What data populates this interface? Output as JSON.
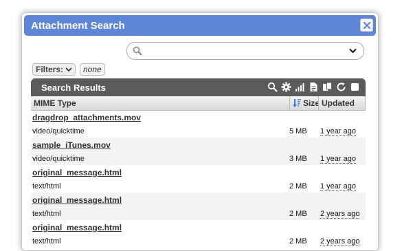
{
  "dialog": {
    "title": "Attachment Search",
    "close_icon": "close-icon"
  },
  "search": {
    "placeholder": "",
    "value": "",
    "icon": "search-icon"
  },
  "filters": {
    "label": "Filters:",
    "value": "none"
  },
  "results": {
    "title": "Search Results",
    "tools": [
      "search-icon",
      "gear-icon",
      "signal-bars-icon",
      "document-icon",
      "copy-icon",
      "refresh-icon",
      "checkbox"
    ]
  },
  "columns": {
    "mime": "MIME Type",
    "size": "Size",
    "updated": "Updated",
    "sort_icon": "sort-descending-icon"
  },
  "rows": [
    {
      "name": "dragdrop_attachments.mov",
      "mime": "video/quicktime",
      "size": "5 MB",
      "updated": "1 year ago"
    },
    {
      "name": "sample_iTunes.mov",
      "mime": "video/quicktime",
      "size": "3 MB",
      "updated": "1 year ago"
    },
    {
      "name": "original_message.html",
      "mime": "text/html",
      "size": "2 MB",
      "updated": "1 year ago"
    },
    {
      "name": "original_message.html",
      "mime": "text/html",
      "size": "2 MB",
      "updated": "2 years ago"
    },
    {
      "name": "original_message.html",
      "mime": "text/html",
      "size": "2 MB",
      "updated": "2 years ago"
    }
  ],
  "colors": {
    "titlebar": "#5f86d6",
    "results_bar": "#5b5b5b"
  }
}
